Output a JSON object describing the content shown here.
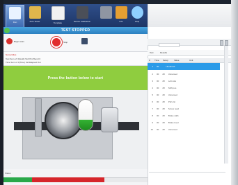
{
  "ribbon": {
    "buttons": [
      {
        "label": "Run",
        "color": "#ffffff"
      },
      {
        "label": "Auto Tester",
        "color": "#e0b64c"
      },
      {
        "label": "Template",
        "color": "#d84141"
      },
      {
        "label": "Device Calibration",
        "color": "#4b4f58"
      },
      {
        "label": "",
        "color": "#8f96a2"
      },
      {
        "label": "Info",
        "color": "#e59f32"
      },
      {
        "label": "Help",
        "color": "#8fd0ff"
      }
    ]
  },
  "window": {
    "title": "TEST STOPPED"
  },
  "toolbar": {
    "start_label": "Begin scan",
    "stop_label": "Stop",
    "tool_label": ""
  },
  "info": {
    "name_label": "Name/Alias",
    "line1": "Test  Sum of: 0(Hold)  Std   Print/Send   0",
    "line2": "Time   Sum of 0(Time)  Std   Elapsed   Out"
  },
  "banner": {
    "text": "Press the button below to start"
  },
  "footer": {
    "label": "Status"
  },
  "status": {
    "progress_colors": [
      "#2aa84a",
      "#d6262b",
      "#e8e9eb"
    ]
  },
  "right_panel": {
    "header": "",
    "search_placeholder": "",
    "tabs": [
      "Test",
      "Results"
    ],
    "columns": [
      "#",
      "Time",
      "Setup",
      "Value",
      "Unit"
    ],
    "rows": [
      {
        "k": "1",
        "a": "00",
        "b": "",
        "c": "Unnamed"
      },
      {
        "k": "2",
        "a": "00",
        "b": "28",
        "c": "Unnamed"
      },
      {
        "k": "3",
        "a": "00",
        "b": "28",
        "c": "Left side"
      },
      {
        "k": "4",
        "a": "00",
        "b": "28",
        "c": "Shift pos"
      },
      {
        "k": "5",
        "a": "00",
        "b": "28",
        "c": "Unnamed"
      },
      {
        "k": "6",
        "a": "00",
        "b": "28",
        "c": "PE Unit"
      },
      {
        "k": "7",
        "a": "00",
        "b": "28",
        "c": "Screw  read"
      },
      {
        "k": "8",
        "a": "00",
        "b": "28",
        "c": "Brake calib"
      },
      {
        "k": "9",
        "a": "00",
        "b": "28",
        "c": "Brake level"
      },
      {
        "k": "10",
        "a": "00",
        "b": "28",
        "c": "Unnamed"
      }
    ]
  }
}
